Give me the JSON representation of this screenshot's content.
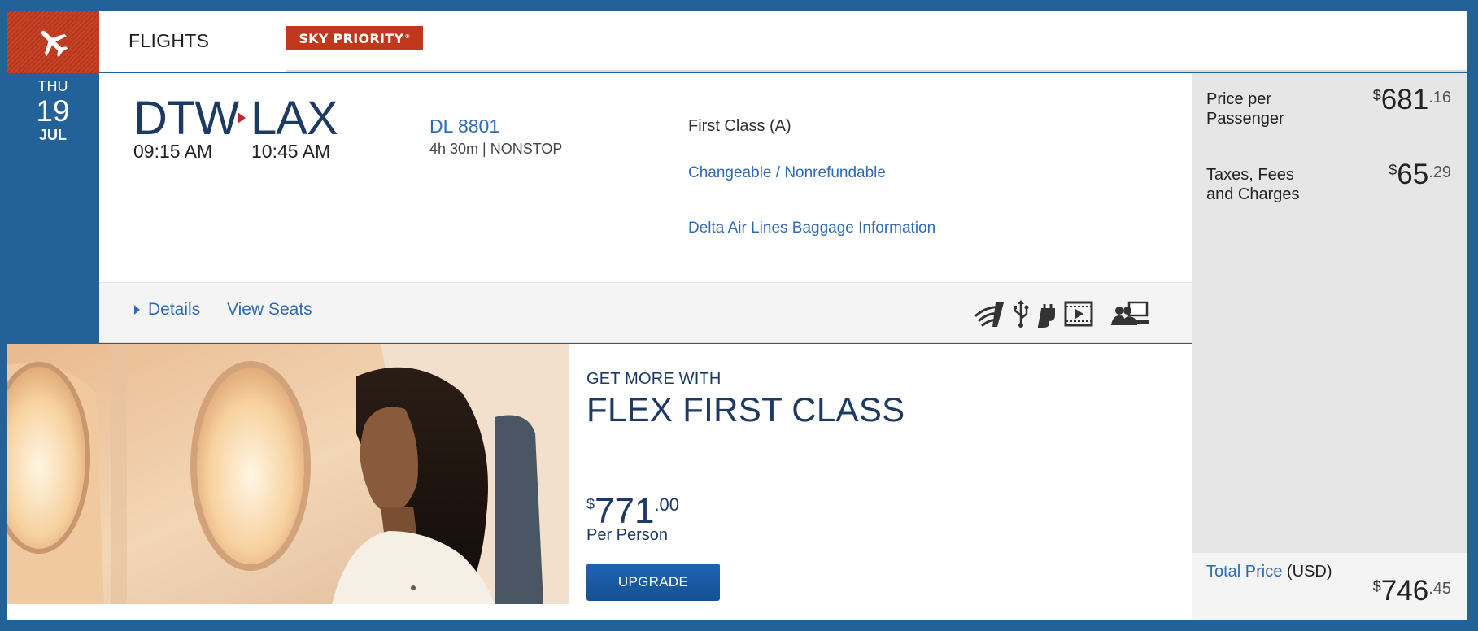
{
  "header": {
    "section_title": "FLIGHTS",
    "badge": "SKY PRIORITY",
    "badge_mark": "®"
  },
  "date": {
    "day_of_week": "THU",
    "day": "19",
    "month": "JUL"
  },
  "flight": {
    "origin": "DTW",
    "destination": "LAX",
    "depart_time": "09:15 AM",
    "arrive_time": "10:45 AM",
    "flight_number": "DL 8801",
    "duration": "4h 30m | NONSTOP",
    "cabin": "First Class (A)",
    "fare_rules_link": "Changeable / Nonrefundable",
    "baggage_link": "Delta Air Lines Baggage Information"
  },
  "actions": {
    "details": "Details",
    "view_seats": "View Seats"
  },
  "amenities": [
    "wifi-icon",
    "usb-icon",
    "power-outlet-icon",
    "entertainment-icon",
    "personal-screen-icon"
  ],
  "pricing": {
    "price_per_passenger_label": "Price per Passenger",
    "price_per_passenger": {
      "currency": "$",
      "dollars": "681",
      "cents": ".16"
    },
    "taxes_label": "Taxes, Fees and Charges",
    "taxes": {
      "currency": "$",
      "dollars": "65",
      "cents": ".29"
    },
    "total_label": "Total Price",
    "total_unit": " (USD)",
    "total": {
      "currency": "$",
      "dollars": "746",
      "cents": ".45"
    }
  },
  "upsell": {
    "kicker": "GET MORE WITH",
    "title": "FLEX FIRST CLASS",
    "price": {
      "currency": "$",
      "dollars": "771",
      "cents": ".00"
    },
    "price_note": "Per Person",
    "button": "UPGRADE"
  },
  "colors": {
    "brand_blue": "#236299",
    "brand_red": "#c0381c",
    "link_blue": "#2f6bb3",
    "navy": "#1c3a63"
  }
}
